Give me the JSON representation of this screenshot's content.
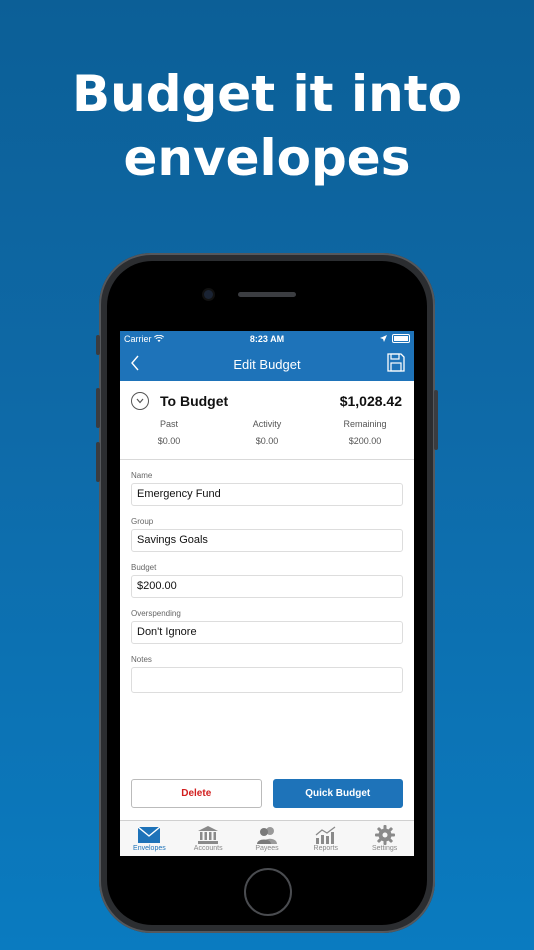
{
  "headline": {
    "line1": "Budget it into",
    "line2": "envelopes"
  },
  "status": {
    "carrier": "Carrier",
    "time": "8:23 AM"
  },
  "nav": {
    "title": "Edit Budget"
  },
  "summary": {
    "label": "To Budget",
    "amount": "$1,028.42",
    "stats": [
      {
        "label": "Past",
        "value": "$0.00"
      },
      {
        "label": "Activity",
        "value": "$0.00"
      },
      {
        "label": "Remaining",
        "value": "$200.00"
      }
    ]
  },
  "form": {
    "name_label": "Name",
    "name_value": "Emergency Fund",
    "group_label": "Group",
    "group_value": "Savings Goals",
    "budget_label": "Budget",
    "budget_value": "$200.00",
    "overspending_label": "Overspending",
    "overspending_value": "Don't Ignore",
    "notes_label": "Notes",
    "notes_value": ""
  },
  "actions": {
    "delete_label": "Delete",
    "quick_label": "Quick Budget"
  },
  "tabs": [
    {
      "label": "Envelopes",
      "icon": "envelope-icon",
      "active": true
    },
    {
      "label": "Accounts",
      "icon": "bank-icon",
      "active": false
    },
    {
      "label": "Payees",
      "icon": "people-icon",
      "active": false
    },
    {
      "label": "Reports",
      "icon": "chart-icon",
      "active": false
    },
    {
      "label": "Settings",
      "icon": "gear-icon",
      "active": false
    }
  ],
  "colors": {
    "accent": "#1e73b9",
    "delete": "#d21f1f",
    "background": "#0e6aa8"
  }
}
